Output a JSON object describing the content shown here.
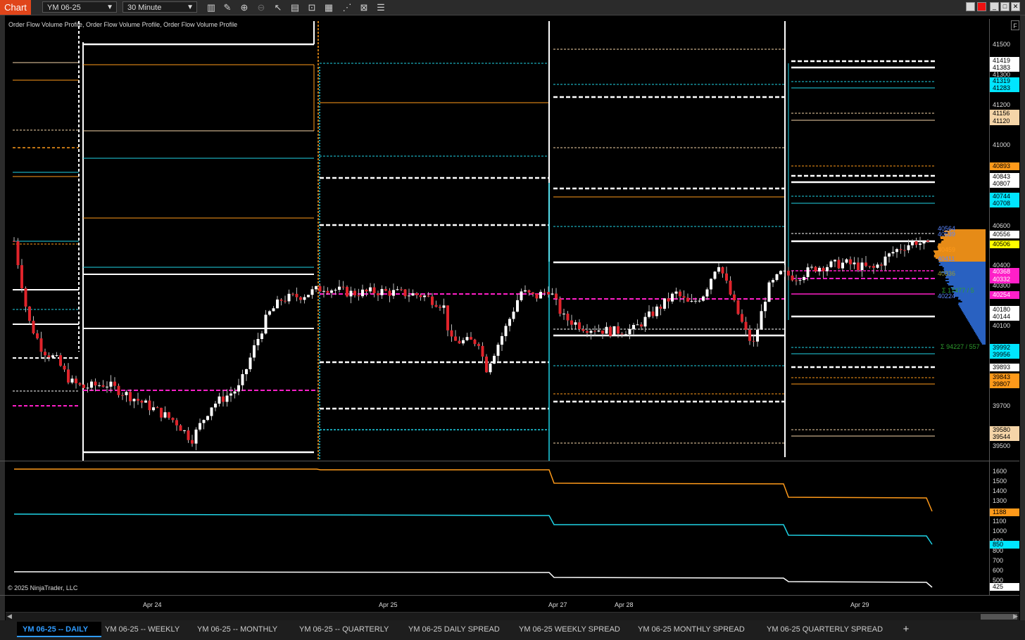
{
  "toolbar": {
    "app_label": "Chart",
    "instrument": "YM 06-25",
    "interval": "30 Minute",
    "icons": [
      "bar-type-icon",
      "pencil-draw-icon",
      "zoom-in-icon",
      "zoom-out-icon",
      "pointer-icon",
      "properties-icon",
      "data-box-icon",
      "indicators-icon",
      "strategies-icon",
      "template-icon",
      "list-icon"
    ]
  },
  "chart": {
    "indicator_label": "Order Flow Volume Profile, Order Flow Volume Profile, Order Flow Volume Profile",
    "copyright": "© 2025 NinjaTrader, LLC",
    "f_button": "F",
    "price_axis_ticks": [
      "41500",
      "41300",
      "41200",
      "41000",
      "40600",
      "40400",
      "40300",
      "40100",
      "39700",
      "39500"
    ],
    "price_tags": [
      {
        "text": "41419",
        "bg": "#ffffff",
        "fg": "#000000"
      },
      {
        "text": "41383",
        "bg": "#ffffff",
        "fg": "#000000"
      },
      {
        "text": "41319",
        "bg": "#00e5ff",
        "fg": "#000000"
      },
      {
        "text": "41283",
        "bg": "#00e5ff",
        "fg": "#000000"
      },
      {
        "text": "41156",
        "bg": "#f5d5a8",
        "fg": "#000000"
      },
      {
        "text": "41120",
        "bg": "#f5d5a8",
        "fg": "#000000"
      },
      {
        "text": "40893",
        "bg": "#ff9a1a",
        "fg": "#000000"
      },
      {
        "text": "40843",
        "bg": "#ffffff",
        "fg": "#000000"
      },
      {
        "text": "40807",
        "bg": "#ffffff",
        "fg": "#000000"
      },
      {
        "text": "40744",
        "bg": "#00e5ff",
        "fg": "#000000"
      },
      {
        "text": "40708",
        "bg": "#00e5ff",
        "fg": "#000000"
      },
      {
        "text": "40556",
        "bg": "#ffffff",
        "fg": "#000000"
      },
      {
        "text": "40506",
        "bg": "#ffff00",
        "fg": "#000000"
      },
      {
        "text": "40368",
        "bg": "#ff1fc8",
        "fg": "#ffffff"
      },
      {
        "text": "40332",
        "bg": "#ff1fc8",
        "fg": "#ffffff"
      },
      {
        "text": "40254",
        "bg": "#ff1fc8",
        "fg": "#ffffff"
      },
      {
        "text": "40180",
        "bg": "#ffffff",
        "fg": "#000000"
      },
      {
        "text": "40144",
        "bg": "#ffffff",
        "fg": "#000000"
      },
      {
        "text": "39992",
        "bg": "#00e5ff",
        "fg": "#000000"
      },
      {
        "text": "39956",
        "bg": "#00e5ff",
        "fg": "#000000"
      },
      {
        "text": "39893",
        "bg": "#ffffff",
        "fg": "#000000"
      },
      {
        "text": "39843",
        "bg": "#ff9a1a",
        "fg": "#000000"
      },
      {
        "text": "39807",
        "bg": "#ff9a1a",
        "fg": "#000000"
      },
      {
        "text": "39580",
        "bg": "#f5d5a8",
        "fg": "#000000"
      },
      {
        "text": "39544",
        "bg": "#f5d5a8",
        "fg": "#000000"
      }
    ],
    "profile_labels": [
      "40564",
      "40539",
      "40459",
      "40411",
      "40336",
      "40224",
      "Σ 17477 / 5",
      "Σ 94227 / 557"
    ],
    "lower_axis_ticks": [
      "1600",
      "1500",
      "1400",
      "1300",
      "1100",
      "1000",
      "900",
      "800",
      "700",
      "600",
      "500"
    ],
    "lower_tags": [
      {
        "text": "1188",
        "bg": "#ff9a1a",
        "fg": "#000000"
      },
      {
        "text": "850",
        "bg": "#00e5ff",
        "fg": "#000000"
      },
      {
        "text": "425",
        "bg": "#ffffff",
        "fg": "#000000"
      }
    ],
    "date_labels": [
      "Apr 24",
      "Apr 25",
      "Apr 27",
      "Apr 28",
      "Apr 29"
    ],
    "colors": {
      "orange": "#ff9a1a",
      "cyan": "#1fd3e6",
      "white": "#ffffff",
      "tan": "#f5d5a8",
      "magenta": "#ff1fc8",
      "up_candle": "#ffffff",
      "down_candle": "#e0242b"
    }
  },
  "tabs": [
    {
      "label": "YM 06-25 -- DAILY",
      "active": true
    },
    {
      "label": "YM 06-25 -- WEEKLY",
      "active": false
    },
    {
      "label": "YM 06-25 -- MONTHLY",
      "active": false
    },
    {
      "label": "YM 06-25 -- QUARTERLY",
      "active": false
    },
    {
      "label": "YM 06-25 DAILY SPREAD",
      "active": false
    },
    {
      "label": "YM 06-25 WEEKLY SPREAD",
      "active": false
    },
    {
      "label": "YM 06-25 MONTHLY SPREAD",
      "active": false
    },
    {
      "label": "YM 06-25 QUARTERLY SPREAD",
      "active": false
    }
  ],
  "add_tab": "+"
}
